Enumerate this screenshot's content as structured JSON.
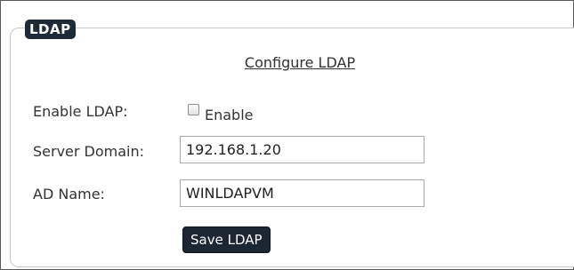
{
  "panel": {
    "legend": "LDAP",
    "heading": "Configure LDAP"
  },
  "form": {
    "enable_label": "Enable LDAP:",
    "enable_checkbox_text": "Enable",
    "enable_checked": false,
    "server_domain_label": "Server Domain:",
    "server_domain_value": "192.168.1.20",
    "ad_name_label": "AD Name:",
    "ad_name_value": "WINLDAPVM",
    "save_label": "Save LDAP"
  }
}
